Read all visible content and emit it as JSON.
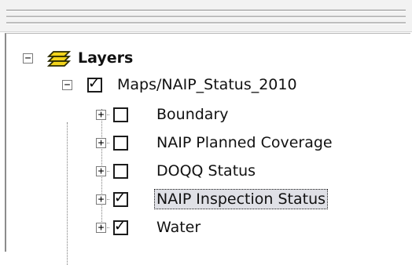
{
  "toc": {
    "root": {
      "label": "Layers",
      "expander": "−",
      "icon": "layers-stack-icon"
    },
    "service": {
      "label": "Maps/NAIP_Status_2010",
      "checked": true,
      "expander": "−"
    },
    "layers": [
      {
        "label": "Boundary",
        "checked": false,
        "expander": "+"
      },
      {
        "label": "NAIP Planned Coverage",
        "checked": false,
        "expander": "+"
      },
      {
        "label": "DOQQ Status",
        "checked": false,
        "expander": "+"
      },
      {
        "label": "NAIP Inspection Status",
        "checked": true,
        "expander": "+",
        "selected": true
      },
      {
        "label": "Water",
        "checked": true,
        "expander": "+"
      }
    ]
  },
  "colors": {
    "selection_background": "#dfe0e6",
    "layers_icon_fill": "#f2d41c",
    "layers_icon_stroke": "#2a2a00"
  }
}
